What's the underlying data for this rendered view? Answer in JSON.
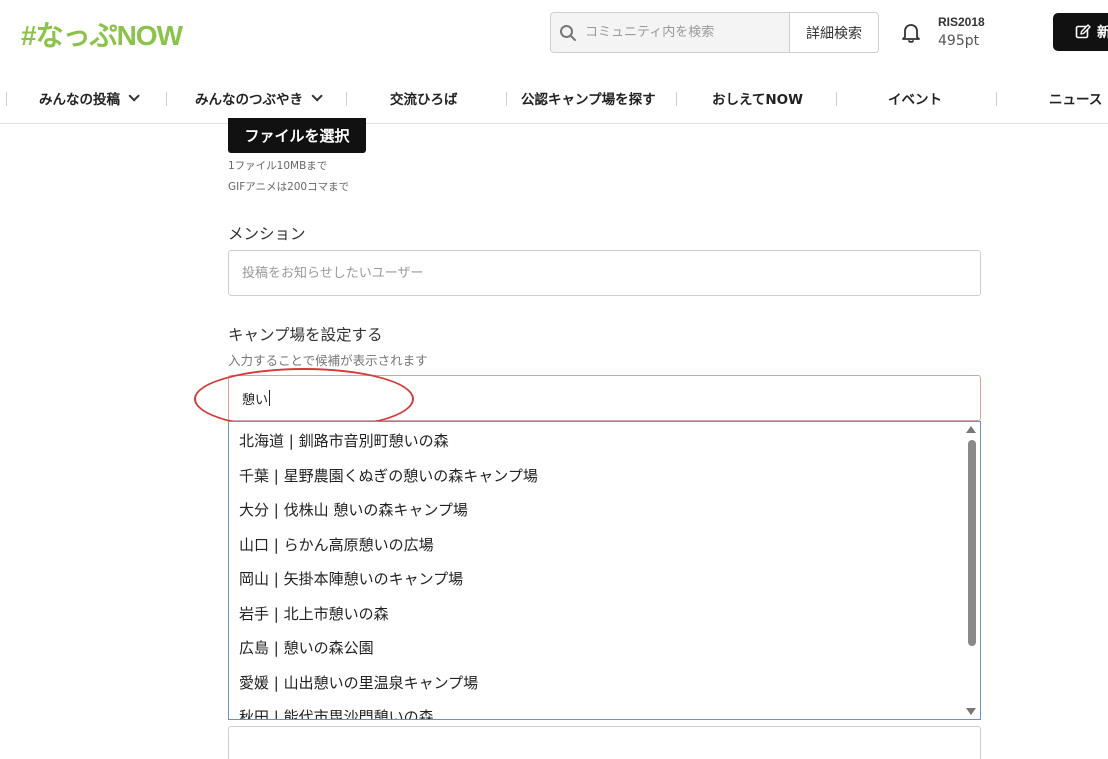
{
  "header": {
    "logo": "#なっぷNOW",
    "search_placeholder": "コミュニティ内を検索",
    "advanced_search": "詳細検索",
    "user_name": "RIS2018",
    "user_points": "495pt",
    "post_button": "新"
  },
  "nav": [
    {
      "label": "みんなの投稿",
      "dropdown": true
    },
    {
      "label": "みんなのつぶやき",
      "dropdown": true
    },
    {
      "label": "交流ひろば",
      "dropdown": false
    },
    {
      "label": "公認キャンプ場を探す",
      "dropdown": false
    },
    {
      "label": "おしえてNOW",
      "dropdown": false
    },
    {
      "label": "イベント",
      "dropdown": false
    },
    {
      "label": "ニュース",
      "dropdown": false
    }
  ],
  "form": {
    "file_button": "ファイルを選択",
    "file_note1": "1ファイル10MBまで",
    "file_note2": "GIFアニメは200コマまで",
    "mention_label": "メンション",
    "mention_placeholder": "投稿をお知らせしたいユーザー",
    "camp_label": "キャンプ場を設定する",
    "camp_hint": "入力することで候補が表示されます",
    "camp_value": "憩い"
  },
  "suggestions": [
    "北海道 | 釧路市音別町憩いの森",
    "千葉 | 星野農園くぬぎの憩いの森キャンプ場",
    "大分 | 伐株山 憩いの森キャンプ場",
    "山口 | らかん高原憩いの広場",
    "岡山 | 矢掛本陣憩いのキャンプ場",
    "岩手 | 北上市憩いの森",
    "広島 | 憩いの森公園",
    "愛媛 | 山出憩いの里温泉キャンプ場",
    "秋田 | 能代市毘沙門憩いの森"
  ],
  "colors": {
    "brand": "#8bc34a",
    "annotation": "#d43a3a",
    "dropdown_border": "#6f8fc8"
  }
}
